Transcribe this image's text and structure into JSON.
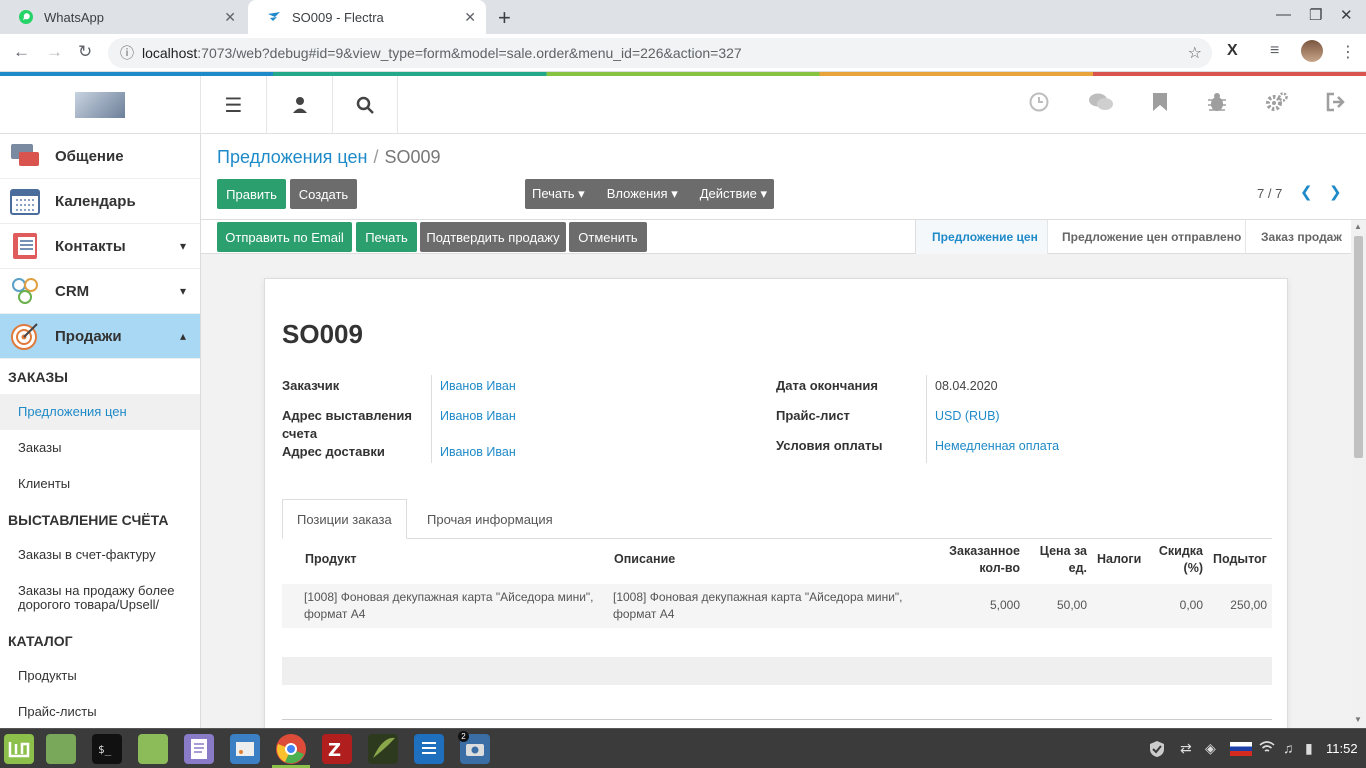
{
  "browser": {
    "tabs": [
      {
        "title": "WhatsApp",
        "active": false
      },
      {
        "title": "SO009 - Flectra",
        "active": true
      }
    ],
    "url_host": "localhost",
    "url_path": ":7073/web?debug#id=9&view_type=form&model=sale.order&menu_id=226&action=327"
  },
  "sidebar": {
    "apps": [
      {
        "label": "Общение",
        "has_chevron": false,
        "color": "#d9534f"
      },
      {
        "label": "Календарь",
        "has_chevron": false,
        "color": "#6c8ebf"
      },
      {
        "label": "Контакты",
        "has_chevron": true,
        "chevron": "▾",
        "color": "#e05c5c"
      },
      {
        "label": "CRM",
        "has_chevron": true,
        "chevron": "▾",
        "color": "#5aa0c8"
      },
      {
        "label": "Продажи",
        "has_chevron": true,
        "chevron": "▴",
        "color": "#e07a3a",
        "active": true
      }
    ],
    "sections": [
      {
        "title": "ЗАКАЗЫ",
        "items": [
          "Предложения цен",
          "Заказы",
          "Клиенты"
        ]
      },
      {
        "title": "ВЫСТАВЛЕНИЕ СЧЁТА",
        "items": [
          "Заказы в счет-фактуру",
          "Заказы на продажу более дорогого товара/Upsell/"
        ]
      },
      {
        "title": "КАТАЛОГ",
        "items": [
          "Продукты",
          "Прайс-листы"
        ]
      }
    ]
  },
  "breadcrumb": {
    "parent": "Предложения цен",
    "separator": "/",
    "current": "SO009"
  },
  "buttons": {
    "edit": "Править",
    "create": "Создать",
    "print_menu": "Печать ▾",
    "attachments_menu": "Вложения ▾",
    "action_menu": "Действие ▾",
    "send_email": "Отправить по Email",
    "print": "Печать",
    "confirm_sale": "Подтвердить продажу",
    "cancel": "Отменить"
  },
  "pager": {
    "text": "7 / 7"
  },
  "stages": [
    {
      "label": "Предложение цен",
      "active": true
    },
    {
      "label": "Предложение цен отправлено",
      "active": false
    },
    {
      "label": "Заказ продаж",
      "active": false
    }
  ],
  "record": {
    "name": "SO009",
    "fields_left": [
      {
        "label": "Заказчик",
        "value": "Иванов Иван"
      },
      {
        "label": "Адрес выставления счета",
        "value": "Иванов Иван"
      },
      {
        "label": "Адрес доставки",
        "value": "Иванов Иван"
      }
    ],
    "fields_right": [
      {
        "label": "Дата окончания",
        "value": "08.04.2020"
      },
      {
        "label": "Прайс-лист",
        "value": "USD (RUB)"
      },
      {
        "label": "Условия оплаты",
        "value": "Немедленная оплата"
      }
    ]
  },
  "tabs": [
    "Позиции заказа",
    "Прочая информация"
  ],
  "order_lines": {
    "headers": [
      "Продукт",
      "Описание",
      "Заказанное кол-во",
      "Цена за ед.",
      "Налоги",
      "Скидка (%)",
      "Подытог"
    ],
    "rows": [
      {
        "product": "[1008] Фоновая декупажная карта \"Айседора мини\", формат А4",
        "description": "[1008] Фоновая декупажная карта \"Айседора мини\", формат А4",
        "qty": "5,000",
        "price": "50,00",
        "taxes": "",
        "discount": "0,00",
        "subtotal": "250,00"
      }
    ]
  },
  "taskbar": {
    "clock": "11:52",
    "badge": "2"
  },
  "colors": {
    "accent": "#1f8ac8",
    "primary_btn": "#2c9f6e",
    "secondary_btn": "#6c6c6c",
    "active_app_bg": "#a9d8f5"
  }
}
